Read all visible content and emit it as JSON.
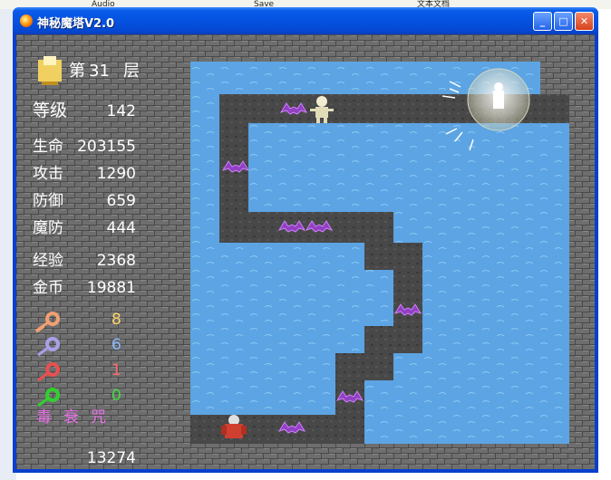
{
  "desktop": {
    "top_labels": [
      "Audio",
      "Save",
      "文本文档"
    ]
  },
  "window": {
    "title": "神秘魔塔V2.0",
    "controls": [
      "minimize",
      "maximize",
      "close"
    ]
  },
  "status": {
    "floor_prefix": "第",
    "floor": "31",
    "floor_suffix": "层",
    "level_label": "等级",
    "level": "142",
    "hp_label": "生命",
    "hp": "203155",
    "atk_label": "攻击",
    "atk": "1290",
    "def_label": "防御",
    "def": "659",
    "mdef_label": "魔防",
    "mdef": "444",
    "exp_label": "经验",
    "exp": "2368",
    "gold_label": "金币",
    "gold": "19881",
    "keys": [
      {
        "color": "yellow",
        "count": "8",
        "hex": "#ffd66a"
      },
      {
        "color": "blue",
        "count": "6",
        "hex": "#8ab8ff"
      },
      {
        "color": "red",
        "count": "1",
        "hex": "#ff6a6a"
      },
      {
        "color": "green",
        "count": "0",
        "hex": "#44dd44"
      }
    ],
    "status_effects": [
      "毒",
      "衰",
      "咒"
    ],
    "bottom_counter": "13274"
  },
  "map": {
    "floor_color": "#484848",
    "water_color": "#5ca4e4",
    "wall_color": "#6e6e6e"
  }
}
